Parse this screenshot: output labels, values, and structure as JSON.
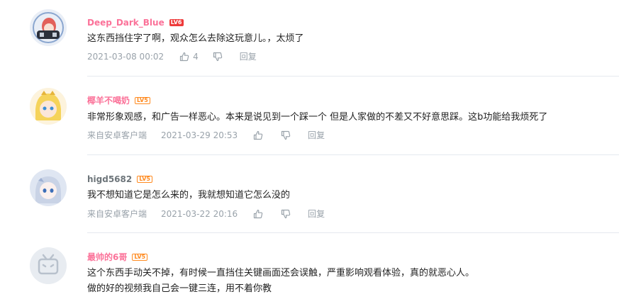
{
  "comments": [
    {
      "username": "Deep_Dark_Blue",
      "level": "LV6",
      "lines": [
        "这东西挡住字了啊，观众怎么去除这玩意儿。，太烦了"
      ],
      "source": "",
      "time": "2021-03-08 00:02",
      "likes": "4",
      "reply": "回复"
    },
    {
      "username": "椰羊不喝奶",
      "level": "LV5",
      "lines": [
        "非常形象观感，和广告一样恶心。本来是说见到一个踩一个 但是人家做的不差又不好意思踩。这b功能给我烦死了"
      ],
      "source": "来自安卓客户端",
      "time": "2021-03-29 20:53",
      "likes": "",
      "reply": "回复"
    },
    {
      "username": "higd5682",
      "level": "LV5",
      "lines": [
        "我不想知道它是怎么来的，我就想知道它怎么没的"
      ],
      "source": "来自安卓客户端",
      "time": "2021-03-22 20:16",
      "likes": "",
      "reply": "回复"
    },
    {
      "username": "最帅的6哥",
      "level": "LV5",
      "lines": [
        "这个东西手动关不掉，有时候一直挡住关键画面还会误触，严重影响观看体验，真的就恶心人。",
        "做的好的视频我自己会一键三连，用不着你教"
      ],
      "source": "",
      "time": "",
      "likes": "",
      "reply": ""
    }
  ],
  "colors": {
    "vip_name": "#fb7299",
    "normal_name": "#6d757a",
    "meta": "#99a2aa",
    "lv6": "#ee3b3b",
    "lv5": "#ff8a1f"
  },
  "icons": [
    "thumbs-up-icon",
    "thumbs-down-icon"
  ]
}
